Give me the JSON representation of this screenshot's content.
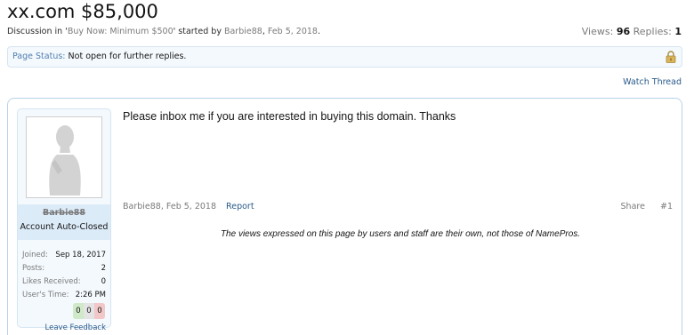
{
  "thread": {
    "title": "xx.com $85,000",
    "discussion_prefix": "Discussion in '",
    "forum": "Buy Now: Minimum $500",
    "started_by": "' started by ",
    "author": "Barbie88",
    "sep": ", ",
    "date": "Feb 5, 2018",
    "period": ".",
    "views_label": "Views:",
    "views": "96",
    "replies_label": "Replies:",
    "replies": "1"
  },
  "status": {
    "label": "Page Status:",
    "value": "Not open for further replies.",
    "icon": "lock-icon"
  },
  "actions": {
    "watch_thread": "Watch Thread"
  },
  "user": {
    "name": "Barbie88",
    "title": "Account Auto-Closed",
    "stats": [
      {
        "key": "Joined:",
        "value": "Sep 18, 2017"
      },
      {
        "key": "Posts:",
        "value": "2"
      },
      {
        "key": "Likes Received:",
        "value": "0"
      },
      {
        "key": "User's Time:",
        "value": "2:26 PM"
      }
    ],
    "ratings": {
      "positive": "0",
      "neutral": "0",
      "negative": "0"
    },
    "feedback_link": "Leave Feedback"
  },
  "post": {
    "message": "Please inbox me if you are interested in buying this domain. Thanks",
    "author": "Barbie88",
    "date": "Feb 5, 2018",
    "report": "Report",
    "share": "Share",
    "number": "#1"
  },
  "disclaimer": "The views expressed on this page by users and staff are their own, not those of NamePros."
}
